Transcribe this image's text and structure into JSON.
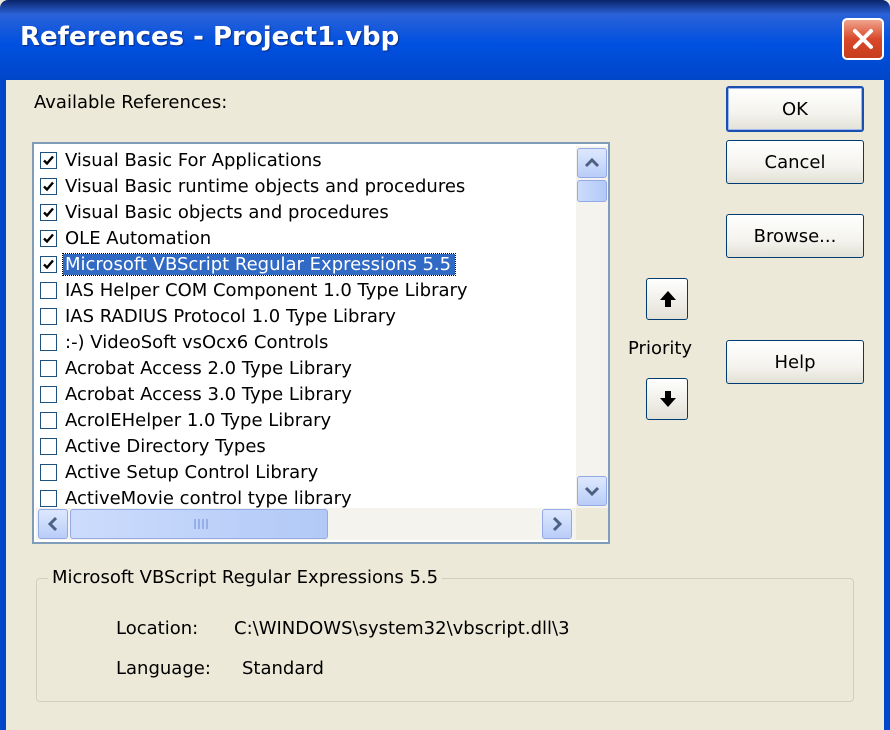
{
  "window": {
    "title": "References - Project1.vbp"
  },
  "labels": {
    "available_references": "Available References:",
    "priority": "Priority"
  },
  "buttons": {
    "ok": "OK",
    "cancel": "Cancel",
    "browse": "Browse...",
    "help": "Help"
  },
  "references": [
    {
      "label": "Visual Basic For Applications",
      "checked": true
    },
    {
      "label": "Visual Basic runtime objects and procedures",
      "checked": true
    },
    {
      "label": "Visual Basic objects and procedures",
      "checked": true
    },
    {
      "label": "OLE Automation",
      "checked": true
    },
    {
      "label": "Microsoft VBScript Regular Expressions 5.5",
      "checked": true,
      "selected": true
    },
    {
      "label": "IAS Helper COM Component 1.0 Type Library",
      "checked": false
    },
    {
      "label": "IAS RADIUS Protocol 1.0 Type Library",
      "checked": false
    },
    {
      "label": ":-) VideoSoft vsOcx6 Controls",
      "checked": false
    },
    {
      "label": "Acrobat Access 2.0 Type Library",
      "checked": false
    },
    {
      "label": "Acrobat Access 3.0 Type Library",
      "checked": false
    },
    {
      "label": "AcroIEHelper 1.0 Type Library",
      "checked": false
    },
    {
      "label": "Active Directory Types",
      "checked": false
    },
    {
      "label": "Active Setup Control Library",
      "checked": false
    },
    {
      "label": "ActiveMovie control type library",
      "checked": false
    }
  ],
  "details": {
    "title": "Microsoft VBScript Regular Expressions 5.5",
    "location_label": "Location:",
    "location_value": "C:\\WINDOWS\\system32\\vbscript.dll\\3",
    "language_label": "Language:",
    "language_value": "Standard"
  },
  "colors": {
    "title_bar": "#0054E3",
    "selection": "#316AC5",
    "dialog_bg": "#ECE9D8"
  },
  "icons": {
    "close": "close-x-icon",
    "priority_up": "arrow-up-icon",
    "priority_down": "arrow-down-icon"
  }
}
